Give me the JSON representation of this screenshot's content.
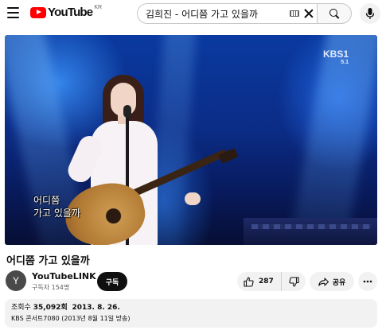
{
  "header": {
    "logo_text": "YouTube",
    "logo_region": "KR",
    "search_value": "김희진 - 어디쯤 가고 있을까",
    "icons": [
      "menu-icon",
      "youtube-logo-icon",
      "keyboard-icon",
      "clear-icon",
      "search-icon",
      "microphone-icon"
    ]
  },
  "video": {
    "broadcaster": "KBS1",
    "broadcaster_sub": "5.1",
    "subtitle_line1": "어디쯤",
    "subtitle_line2": "가고 있을까"
  },
  "title": "어디쯤 가고 있을까",
  "channel": {
    "avatar_letter": "Y",
    "name": "YouTubeLINK",
    "subscribers": "구독자 154명",
    "subscribe_label": "구독"
  },
  "actions": {
    "like_count": "287",
    "share_label": "공유",
    "icons": [
      "thumbs-up-icon",
      "thumbs-down-icon",
      "share-icon",
      "more-icon"
    ]
  },
  "description": {
    "views_label": "조회수",
    "views": "35,092회",
    "date": "2013. 8. 26.",
    "text": "KBS 콘서트7080 (2013년 8월 11일 방송)"
  },
  "colors": {
    "brand_red": "#ff0000",
    "text_primary": "#0f0f0f",
    "text_secondary": "#606060",
    "chip_bg": "#f2f2f2"
  }
}
